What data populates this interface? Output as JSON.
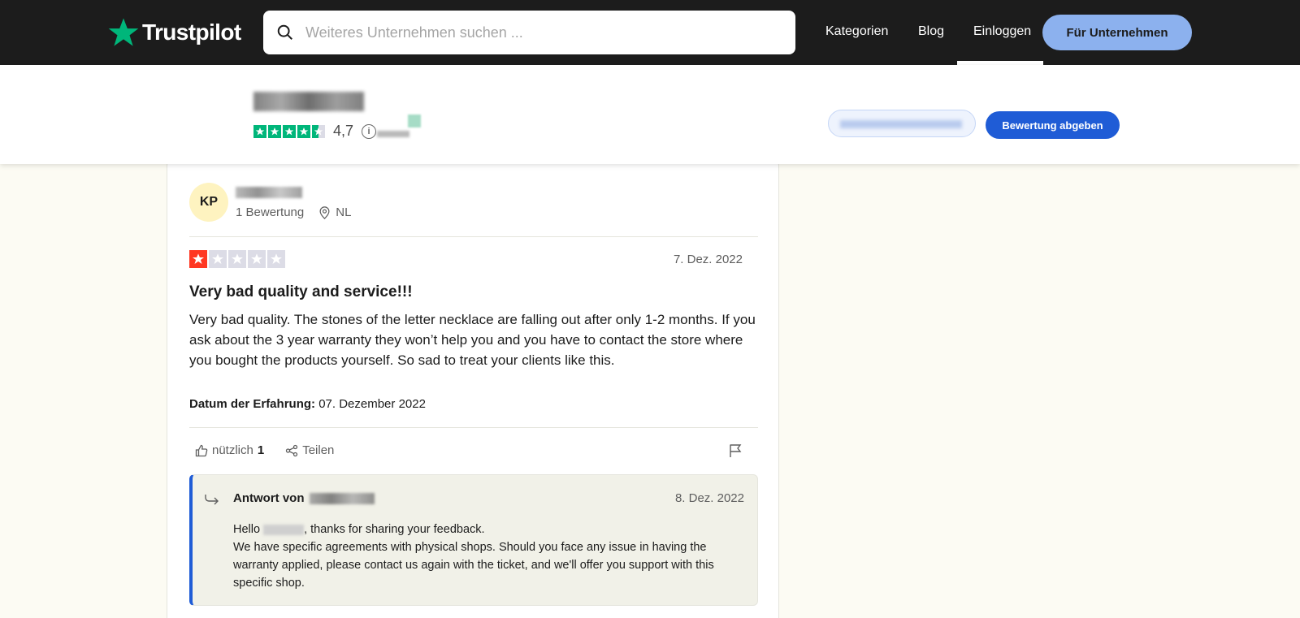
{
  "nav": {
    "brand": "Trustpilot",
    "search_placeholder": "Weiteres Unternehmen suchen ...",
    "links": [
      "Kategorien",
      "Blog",
      "Einloggen"
    ],
    "business_button": "Für Unternehmen"
  },
  "company": {
    "rating_score": "4,7",
    "stars": 4.5,
    "info_icon": "i",
    "write_review_button": "Bewertung abgeben"
  },
  "review": {
    "avatar_initials": "KP",
    "review_count": "1 Bewertung",
    "country": "NL",
    "stars": 1,
    "date": "7. Dez. 2022",
    "title": "Very bad quality and service!!!",
    "body": "Very bad quality. The stones of the letter necklace are falling out after only 1-2 months. If you ask about the 3 year warranty they won’t help you and you have to contact the store where you bought the products yourself. So sad to treat your clients like this.",
    "experience_label": "Datum der Erfahrung:",
    "experience_date": "07. Dezember 2022",
    "useful_label": "nützlich",
    "useful_count": "1",
    "share_label": "Teilen"
  },
  "reply": {
    "from_label": "Antwort von",
    "date": "8. Dez. 2022",
    "greeting_prefix": "Hello",
    "greeting_suffix": ", thanks for sharing your feedback.",
    "body": "We have specific agreements with physical shops. Should you face any issue in having the warranty applied, please contact us again with the ticket, and we'll offer you support with this specific shop."
  },
  "colors": {
    "nav_bg": "#1c1c1c",
    "brand_green": "#00b67a",
    "business_button": "#8cb1ee",
    "primary_blue": "#1f5cd6",
    "one_star_red": "#ff3722",
    "page_bg": "#fcfbf3"
  }
}
